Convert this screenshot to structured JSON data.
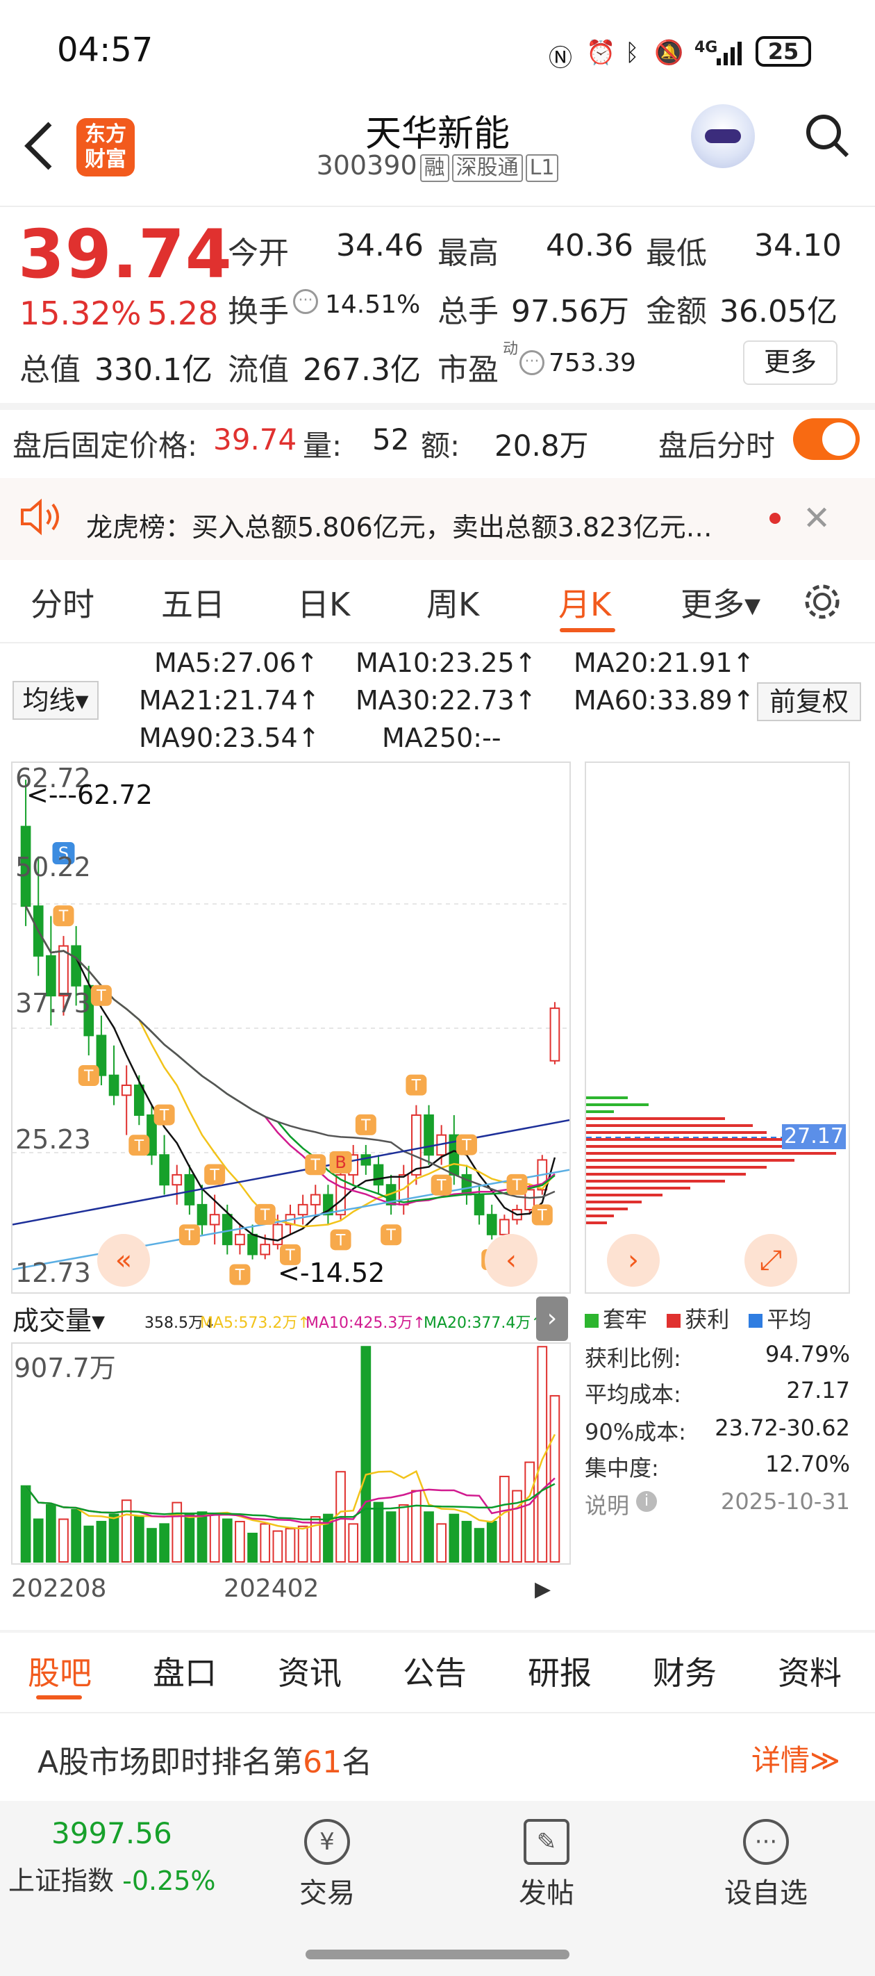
{
  "status_bar": {
    "time": "04:57",
    "network": "4G",
    "battery": "25"
  },
  "header": {
    "logo_line1": "东方",
    "logo_line2": "财富",
    "title": "天华新能",
    "code": "300390",
    "tags": [
      "融",
      "深股通",
      "L1"
    ]
  },
  "quote": {
    "price": "39.74",
    "change_pct": "15.32%",
    "change_abs": "5.28",
    "open_label": "今开",
    "open": "34.46",
    "high_label": "最高",
    "high": "40.36",
    "low_label": "最低",
    "low": "34.10",
    "turnover_label": "换手",
    "turnover": "14.51%",
    "volume_label": "总手",
    "volume": "97.56万",
    "amount_label": "金额",
    "amount": "36.05亿",
    "mktcap_label": "总值",
    "mktcap": "330.1亿",
    "float_label": "流值",
    "float_cap": "267.3亿",
    "pe_label": "市盈",
    "pe_sup": "动",
    "pe": "753.39",
    "more": "更多"
  },
  "after_hours": {
    "label": "盘后固定价格:",
    "price": "39.74",
    "vol_label": "量:",
    "vol": "52",
    "amt_label": "额:",
    "amt": "20.8万",
    "toggle_label": "盘后分时",
    "toggle_on": true
  },
  "notice": {
    "text": "龙虎榜：买入总额5.806亿元，卖出总额3.823亿元…"
  },
  "chart_tabs": [
    {
      "label": "分时"
    },
    {
      "label": "五日"
    },
    {
      "label": "日K"
    },
    {
      "label": "周K"
    },
    {
      "label": "月K",
      "active": true
    },
    {
      "label": "更多▾"
    }
  ],
  "ma_legend": {
    "selector": "均线▾",
    "fuquan": "前复权",
    "items": [
      {
        "text": "MA5:27.06↑",
        "color": "#111111"
      },
      {
        "text": "MA10:23.25↑",
        "color": "#f2c31a"
      },
      {
        "text": "MA20:21.91↑",
        "color": "#d11a8f"
      },
      {
        "text": "MA21:21.74↑",
        "color": "#0a9b2a"
      },
      {
        "text": "MA30:22.73↑",
        "color": "#555555"
      },
      {
        "text": "MA60:33.89↑",
        "color": "#1d2f99"
      },
      {
        "text": "MA90:23.54↑",
        "color": "#5aaee3"
      },
      {
        "text": "MA250:--",
        "color": "#c0282d"
      }
    ]
  },
  "kline": {
    "y_labels": [
      "62.72",
      "50.22",
      "37.73",
      "25.23",
      "12.73"
    ],
    "high_mark": "<---62.72",
    "low_mark": "<-14.52",
    "s_badge": "S",
    "b_badge": "B",
    "t_badge": "T"
  },
  "chip": {
    "avg_label": "27.17",
    "legend": [
      {
        "text": "套牢",
        "color": "#2db52f"
      },
      {
        "text": "获利",
        "color": "#e0312f"
      },
      {
        "text": "平均",
        "color": "#2f7de1"
      }
    ],
    "stats": [
      {
        "label": "获利比例:",
        "value": "94.79%"
      },
      {
        "label": "平均成本:",
        "value": "27.17"
      },
      {
        "label": "90%成本:",
        "value": "23.72-30.62"
      },
      {
        "label": "集中度:",
        "value": "12.70%"
      },
      {
        "label": "说明",
        "value": "2025-10-31"
      }
    ]
  },
  "volume": {
    "selector": "成交量▾",
    "legend": [
      {
        "text": "358.5万↓",
        "color": "#222222"
      },
      {
        "text": "MA5:573.2万↑",
        "color": "#f2c31a"
      },
      {
        "text": "MA10:425.3万↑",
        "color": "#d11a8f"
      },
      {
        "text": "MA20:377.4万↑",
        "color": "#0a9b2a"
      }
    ],
    "y_max": "907.7万",
    "x_labels": [
      "202208",
      "202402"
    ]
  },
  "bottom_tabs": [
    {
      "label": "股吧",
      "active": true
    },
    {
      "label": "盘口"
    },
    {
      "label": "资讯"
    },
    {
      "label": "公告"
    },
    {
      "label": "研报"
    },
    {
      "label": "财务"
    },
    {
      "label": "资料"
    }
  ],
  "rank": {
    "prefix": "A股市场即时排名第",
    "num": "61",
    "suffix": "名",
    "detail": "详情≫"
  },
  "bottom_bar": {
    "index_value": "3997.56",
    "index_name": "上证指数",
    "index_change": "-0.25%",
    "actions": [
      {
        "label": "交易",
        "icon": "¥"
      },
      {
        "label": "发帖",
        "icon": "✎"
      },
      {
        "label": "设自选",
        "icon": "···"
      }
    ]
  },
  "chart_data": {
    "type": "candlestick",
    "ylim": [
      12.73,
      62.72
    ],
    "candles": [
      [
        58,
        62.7,
        48,
        50
      ],
      [
        50,
        55,
        43,
        45
      ],
      [
        45,
        49,
        38,
        41
      ],
      [
        41,
        47,
        39,
        46
      ],
      [
        46,
        48,
        40,
        42
      ],
      [
        42,
        44,
        35,
        37
      ],
      [
        37,
        39,
        32,
        33
      ],
      [
        33,
        36,
        30,
        31
      ],
      [
        31,
        34,
        27,
        32
      ],
      [
        32,
        33,
        28,
        29
      ],
      [
        29,
        30,
        24,
        25
      ],
      [
        25,
        27,
        21,
        22
      ],
      [
        22,
        24,
        20,
        23
      ],
      [
        23,
        24,
        19,
        20
      ],
      [
        20,
        22,
        17,
        18
      ],
      [
        18,
        21,
        16,
        19
      ],
      [
        19,
        20,
        15,
        16
      ],
      [
        16,
        18,
        15,
        17
      ],
      [
        17,
        18,
        14.5,
        15
      ],
      [
        15,
        17,
        14.52,
        16
      ],
      [
        16,
        19,
        15.5,
        18
      ],
      [
        18,
        20,
        17,
        19
      ],
      [
        19,
        21,
        18,
        20
      ],
      [
        20,
        22,
        19,
        21
      ],
      [
        21,
        22,
        18,
        19
      ],
      [
        19,
        24,
        18.5,
        23
      ],
      [
        23,
        26,
        22,
        25
      ],
      [
        25,
        26,
        23,
        24
      ],
      [
        24,
        25,
        21,
        22
      ],
      [
        22,
        23,
        19,
        20
      ],
      [
        20,
        24,
        19,
        23
      ],
      [
        23,
        30,
        22,
        29
      ],
      [
        29,
        30,
        24,
        25
      ],
      [
        25,
        28,
        24,
        27
      ],
      [
        27,
        29,
        22,
        23
      ],
      [
        23,
        24,
        20,
        21
      ],
      [
        21,
        22,
        18,
        19
      ],
      [
        19,
        20,
        16.5,
        17
      ],
      [
        17,
        19,
        16,
        18.5
      ],
      [
        18.5,
        20,
        18,
        19.5
      ],
      [
        19.5,
        22,
        19,
        21.5
      ],
      [
        21.5,
        25,
        21,
        24.5
      ],
      [
        34.46,
        40.36,
        34.1,
        39.74
      ]
    ],
    "volume": [
      320,
      180,
      240,
      180,
      220,
      150,
      170,
      200,
      260,
      190,
      140,
      160,
      250,
      200,
      210,
      200,
      180,
      170,
      120,
      160,
      130,
      140,
      150,
      190,
      200,
      380,
      160,
      907,
      250,
      210,
      240,
      300,
      210,
      160,
      200,
      170,
      140,
      170,
      360,
      300,
      420,
      907,
      700
    ]
  }
}
